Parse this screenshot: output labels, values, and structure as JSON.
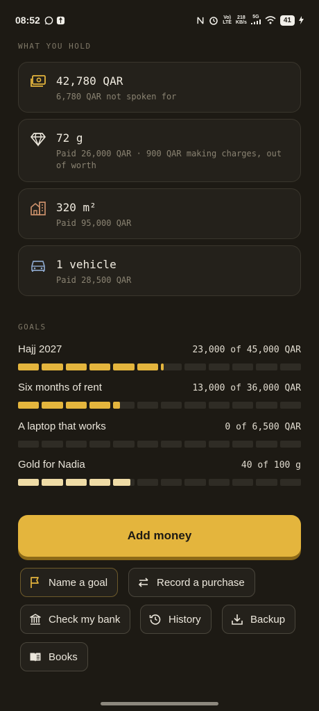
{
  "status_bar": {
    "time": "08:52",
    "network_top": "Vo)",
    "network_bottom": "LTE",
    "speed_top": "218",
    "speed_bottom": "KB/s",
    "gen": "5G",
    "battery": "41"
  },
  "holdings": {
    "section_label": "WHAT YOU HOLD",
    "items": [
      {
        "icon": "cash-icon",
        "main": "42,780 QAR",
        "sub": "6,780 QAR not spoken for"
      },
      {
        "icon": "diamond-icon",
        "main": "72 g",
        "sub": "Paid 26,000 QAR · 900 QAR making charges, out of worth"
      },
      {
        "icon": "building-icon",
        "main": "320 m²",
        "sub": "Paid 95,000 QAR"
      },
      {
        "icon": "car-icon",
        "main": "1 vehicle",
        "sub": "Paid 28,500 QAR"
      }
    ]
  },
  "goals": {
    "section_label": "GOALS",
    "items": [
      {
        "name": "Hajj 2027",
        "amount": "23,000 of 45,000 QAR",
        "progress": 0.511,
        "color": "#e4b53d"
      },
      {
        "name": "Six months of rent",
        "amount": "13,000 of 36,000 QAR",
        "progress": 0.361,
        "color": "#e4b53d"
      },
      {
        "name": "A laptop that works",
        "amount": "0 of 6,500 QAR",
        "progress": 0,
        "color": "#e4b53d"
      },
      {
        "name": "Gold for Nadia",
        "amount": "40 of 100 g",
        "progress": 0.4,
        "color": "#efdca6"
      }
    ]
  },
  "actions": {
    "add_money": "Add money",
    "name_goal": "Name a goal",
    "record_purchase": "Record a purchase",
    "check_bank": "Check my bank",
    "history": "History",
    "backup": "Backup",
    "books": "Books"
  },
  "colors": {
    "accent": "#e4b53d",
    "background": "#1d1a14",
    "card": "#24211b",
    "icon_gold": "#e4b53d",
    "icon_copper": "#c98f6a",
    "icon_blue": "#8aa4c8"
  }
}
